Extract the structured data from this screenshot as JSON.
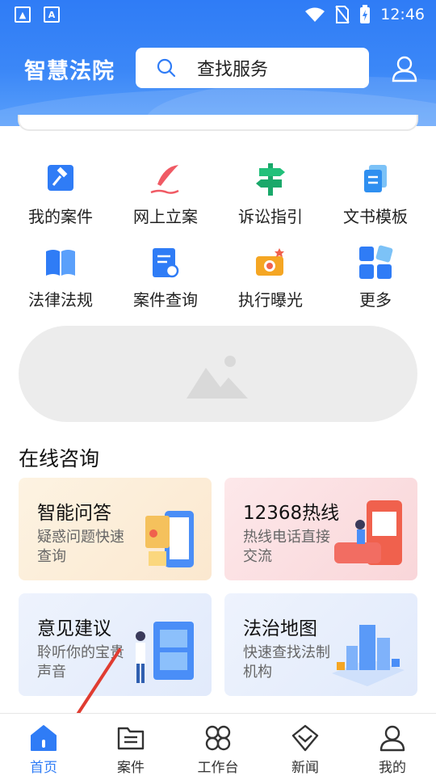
{
  "status_bar": {
    "time": "12:46"
  },
  "header": {
    "app_title": "智慧法院",
    "search": {
      "placeholder": "查找服务"
    }
  },
  "services": [
    {
      "label": "我的案件",
      "icon": "gavel-icon"
    },
    {
      "label": "网上立案",
      "icon": "quill-icon"
    },
    {
      "label": "诉讼指引",
      "icon": "signpost-icon"
    },
    {
      "label": "文书模板",
      "icon": "documents-icon"
    },
    {
      "label": "法律法规",
      "icon": "book-icon"
    },
    {
      "label": "案件查询",
      "icon": "search-document-icon"
    },
    {
      "label": "执行曝光",
      "icon": "camera-icon"
    },
    {
      "label": "更多",
      "icon": "grid-more-icon"
    }
  ],
  "section_title": "在线咨询",
  "consult_cards": [
    {
      "title": "智能问答",
      "subtitle": "疑惑问题快速查询"
    },
    {
      "title": "12368热线",
      "subtitle": "热线电话直接交流"
    },
    {
      "title": "意见建议",
      "subtitle": "聆听你的宝贵声音"
    },
    {
      "title": "法治地图",
      "subtitle": "快速查找法制机构"
    }
  ],
  "bottom_nav": [
    {
      "label": "首页",
      "icon": "home-icon",
      "active": true
    },
    {
      "label": "案件",
      "icon": "case-folder-icon",
      "active": false
    },
    {
      "label": "工作台",
      "icon": "workbench-icon",
      "active": false
    },
    {
      "label": "新闻",
      "icon": "news-icon",
      "active": false
    },
    {
      "label": "我的",
      "icon": "profile-icon",
      "active": false
    }
  ],
  "colors": {
    "primary": "#2f7cf6",
    "header_light": "#5aa0fb"
  }
}
